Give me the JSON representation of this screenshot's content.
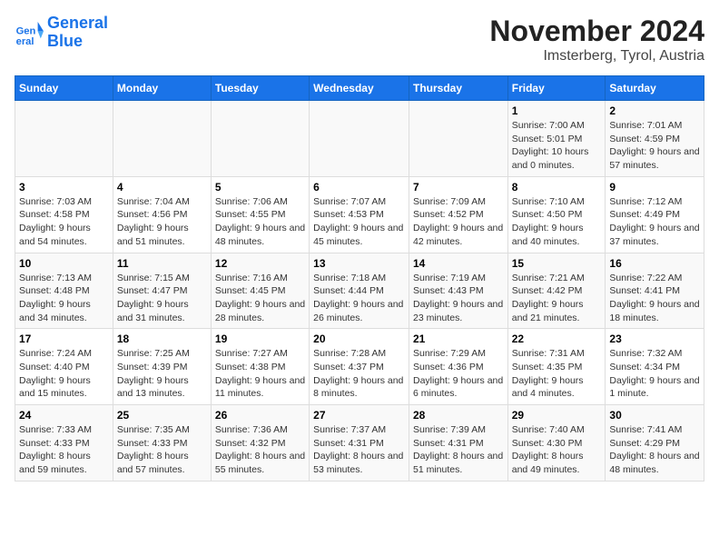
{
  "logo": {
    "line1": "General",
    "line2": "Blue"
  },
  "title": "November 2024",
  "subtitle": "Imsterberg, Tyrol, Austria",
  "days_of_week": [
    "Sunday",
    "Monday",
    "Tuesday",
    "Wednesday",
    "Thursday",
    "Friday",
    "Saturday"
  ],
  "weeks": [
    [
      {
        "day": "",
        "info": ""
      },
      {
        "day": "",
        "info": ""
      },
      {
        "day": "",
        "info": ""
      },
      {
        "day": "",
        "info": ""
      },
      {
        "day": "",
        "info": ""
      },
      {
        "day": "1",
        "info": "Sunrise: 7:00 AM\nSunset: 5:01 PM\nDaylight: 10 hours and 0 minutes."
      },
      {
        "day": "2",
        "info": "Sunrise: 7:01 AM\nSunset: 4:59 PM\nDaylight: 9 hours and 57 minutes."
      }
    ],
    [
      {
        "day": "3",
        "info": "Sunrise: 7:03 AM\nSunset: 4:58 PM\nDaylight: 9 hours and 54 minutes."
      },
      {
        "day": "4",
        "info": "Sunrise: 7:04 AM\nSunset: 4:56 PM\nDaylight: 9 hours and 51 minutes."
      },
      {
        "day": "5",
        "info": "Sunrise: 7:06 AM\nSunset: 4:55 PM\nDaylight: 9 hours and 48 minutes."
      },
      {
        "day": "6",
        "info": "Sunrise: 7:07 AM\nSunset: 4:53 PM\nDaylight: 9 hours and 45 minutes."
      },
      {
        "day": "7",
        "info": "Sunrise: 7:09 AM\nSunset: 4:52 PM\nDaylight: 9 hours and 42 minutes."
      },
      {
        "day": "8",
        "info": "Sunrise: 7:10 AM\nSunset: 4:50 PM\nDaylight: 9 hours and 40 minutes."
      },
      {
        "day": "9",
        "info": "Sunrise: 7:12 AM\nSunset: 4:49 PM\nDaylight: 9 hours and 37 minutes."
      }
    ],
    [
      {
        "day": "10",
        "info": "Sunrise: 7:13 AM\nSunset: 4:48 PM\nDaylight: 9 hours and 34 minutes."
      },
      {
        "day": "11",
        "info": "Sunrise: 7:15 AM\nSunset: 4:47 PM\nDaylight: 9 hours and 31 minutes."
      },
      {
        "day": "12",
        "info": "Sunrise: 7:16 AM\nSunset: 4:45 PM\nDaylight: 9 hours and 28 minutes."
      },
      {
        "day": "13",
        "info": "Sunrise: 7:18 AM\nSunset: 4:44 PM\nDaylight: 9 hours and 26 minutes."
      },
      {
        "day": "14",
        "info": "Sunrise: 7:19 AM\nSunset: 4:43 PM\nDaylight: 9 hours and 23 minutes."
      },
      {
        "day": "15",
        "info": "Sunrise: 7:21 AM\nSunset: 4:42 PM\nDaylight: 9 hours and 21 minutes."
      },
      {
        "day": "16",
        "info": "Sunrise: 7:22 AM\nSunset: 4:41 PM\nDaylight: 9 hours and 18 minutes."
      }
    ],
    [
      {
        "day": "17",
        "info": "Sunrise: 7:24 AM\nSunset: 4:40 PM\nDaylight: 9 hours and 15 minutes."
      },
      {
        "day": "18",
        "info": "Sunrise: 7:25 AM\nSunset: 4:39 PM\nDaylight: 9 hours and 13 minutes."
      },
      {
        "day": "19",
        "info": "Sunrise: 7:27 AM\nSunset: 4:38 PM\nDaylight: 9 hours and 11 minutes."
      },
      {
        "day": "20",
        "info": "Sunrise: 7:28 AM\nSunset: 4:37 PM\nDaylight: 9 hours and 8 minutes."
      },
      {
        "day": "21",
        "info": "Sunrise: 7:29 AM\nSunset: 4:36 PM\nDaylight: 9 hours and 6 minutes."
      },
      {
        "day": "22",
        "info": "Sunrise: 7:31 AM\nSunset: 4:35 PM\nDaylight: 9 hours and 4 minutes."
      },
      {
        "day": "23",
        "info": "Sunrise: 7:32 AM\nSunset: 4:34 PM\nDaylight: 9 hours and 1 minute."
      }
    ],
    [
      {
        "day": "24",
        "info": "Sunrise: 7:33 AM\nSunset: 4:33 PM\nDaylight: 8 hours and 59 minutes."
      },
      {
        "day": "25",
        "info": "Sunrise: 7:35 AM\nSunset: 4:33 PM\nDaylight: 8 hours and 57 minutes."
      },
      {
        "day": "26",
        "info": "Sunrise: 7:36 AM\nSunset: 4:32 PM\nDaylight: 8 hours and 55 minutes."
      },
      {
        "day": "27",
        "info": "Sunrise: 7:37 AM\nSunset: 4:31 PM\nDaylight: 8 hours and 53 minutes."
      },
      {
        "day": "28",
        "info": "Sunrise: 7:39 AM\nSunset: 4:31 PM\nDaylight: 8 hours and 51 minutes."
      },
      {
        "day": "29",
        "info": "Sunrise: 7:40 AM\nSunset: 4:30 PM\nDaylight: 8 hours and 49 minutes."
      },
      {
        "day": "30",
        "info": "Sunrise: 7:41 AM\nSunset: 4:29 PM\nDaylight: 8 hours and 48 minutes."
      }
    ]
  ]
}
